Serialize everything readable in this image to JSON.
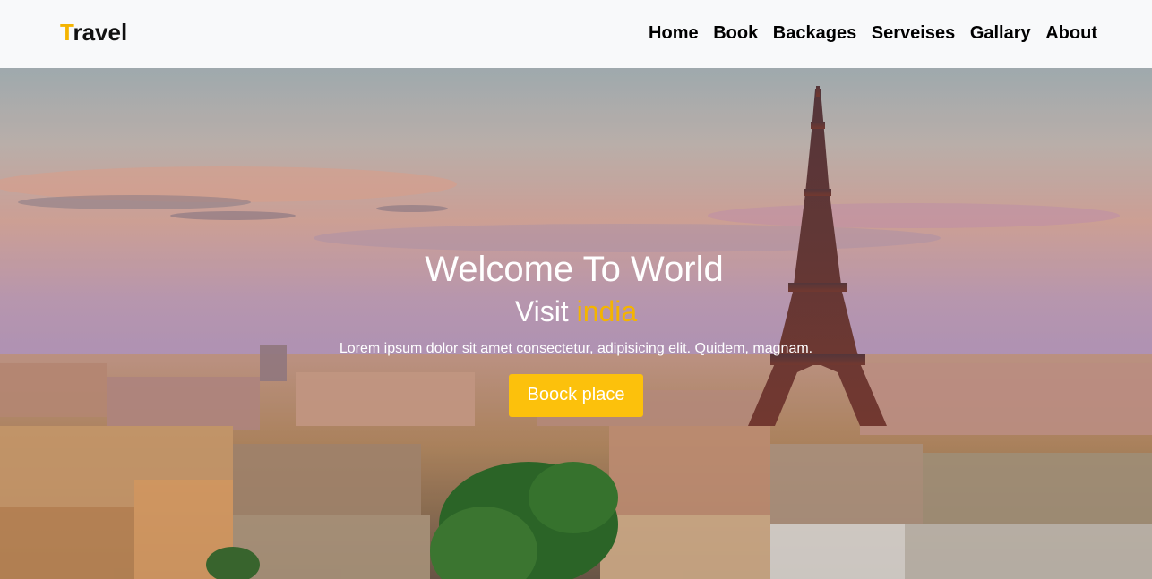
{
  "brand": {
    "first_letter": "T",
    "rest": "ravel"
  },
  "nav": {
    "items": [
      {
        "label": "Home"
      },
      {
        "label": "Book"
      },
      {
        "label": "Backages"
      },
      {
        "label": "Serveises"
      },
      {
        "label": "Gallary"
      },
      {
        "label": "About"
      }
    ]
  },
  "hero": {
    "title": "Welcome To World",
    "subtitle_prefix": "Visit ",
    "subtitle_highlight": "india",
    "text": "Lorem ipsum dolor sit amet consectetur, adipisicing elit. Quidem, magnam.",
    "cta_label": "Boock place",
    "background_icon": "paris-eiffel-tower-cityscape"
  },
  "colors": {
    "accent": "#f4b400",
    "button": "#fcc10c",
    "navbar_bg": "#f8f9fa"
  }
}
